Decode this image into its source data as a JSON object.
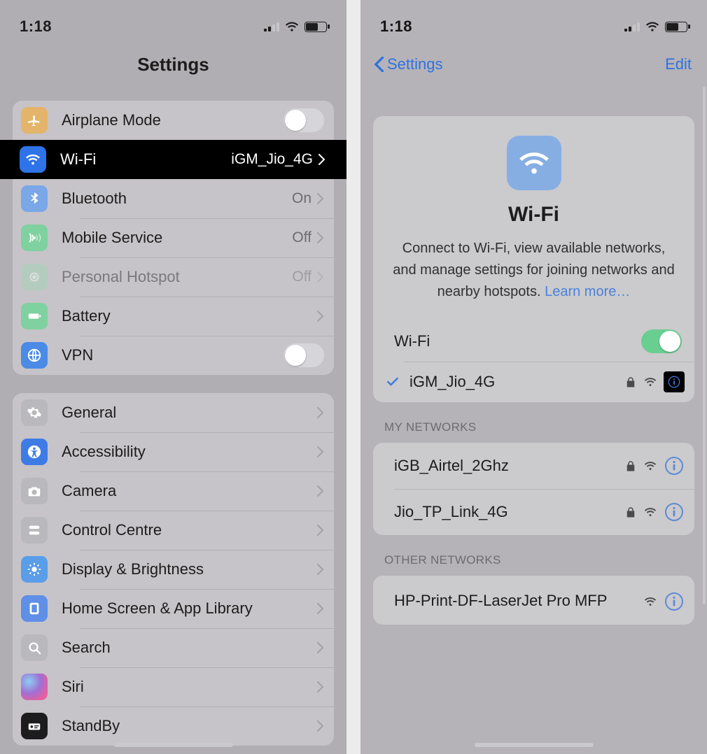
{
  "status": {
    "time": "1:18"
  },
  "left": {
    "title": "Settings",
    "group1": [
      {
        "icon": "airplane",
        "color": "#e3b46a",
        "label": "Airplane Mode",
        "type": "toggle",
        "on": false
      },
      {
        "icon": "wifi",
        "color": "#2e73e8",
        "label": "Wi-Fi",
        "detail": "iGM_Jio_4G",
        "type": "chevron",
        "selected": true
      },
      {
        "icon": "bluetooth",
        "color": "#7aa7e8",
        "label": "Bluetooth",
        "detail": "On",
        "type": "chevron"
      },
      {
        "icon": "antenna",
        "color": "#7fd19f",
        "label": "Mobile Service",
        "detail": "Off",
        "type": "chevron"
      },
      {
        "icon": "hotspot",
        "color": "#9fd7b4",
        "label": "Personal Hotspot",
        "detail": "Off",
        "type": "chevron",
        "faded": true
      },
      {
        "icon": "battery",
        "color": "#7fd19f",
        "label": "Battery",
        "type": "chevron"
      },
      {
        "icon": "vpn",
        "color": "#4b8be6",
        "label": "VPN",
        "type": "toggle",
        "on": false
      }
    ],
    "group2": [
      {
        "icon": "gear",
        "color": "#b8b8bd",
        "label": "General"
      },
      {
        "icon": "accessibility",
        "color": "#3f7be5",
        "label": "Accessibility"
      },
      {
        "icon": "camera",
        "color": "#b8b8bd",
        "label": "Camera"
      },
      {
        "icon": "switches",
        "color": "#b8b8bd",
        "label": "Control Centre"
      },
      {
        "icon": "brightness",
        "color": "#5a9de8",
        "label": "Display & Brightness"
      },
      {
        "icon": "homescreen",
        "color": "#5f8fe6",
        "label": "Home Screen & App Library"
      },
      {
        "icon": "search",
        "color": "#b8b8bd",
        "label": "Search"
      },
      {
        "icon": "siri",
        "color": "siri",
        "label": "Siri"
      },
      {
        "icon": "standby",
        "color": "#1c1c1e",
        "label": "StandBy"
      }
    ]
  },
  "right": {
    "back": "Settings",
    "edit": "Edit",
    "title": "Wi-Fi",
    "desc": "Connect to Wi-Fi, view available networks, and manage settings for joining networks and nearby hotspots. ",
    "learn_more": "Learn more…",
    "wifi_label": "Wi-Fi",
    "wifi_on": true,
    "connected": "iGM_Jio_4G",
    "my_networks_header": "MY NETWORKS",
    "my_networks": [
      {
        "name": "iGB_Airtel_2Ghz",
        "locked": true
      },
      {
        "name": "Jio_TP_Link_4G",
        "locked": true
      }
    ],
    "other_header": "OTHER NETWORKS",
    "other_networks": [
      {
        "name": "HP-Print-DF-LaserJet Pro MFP",
        "locked": false
      }
    ]
  }
}
